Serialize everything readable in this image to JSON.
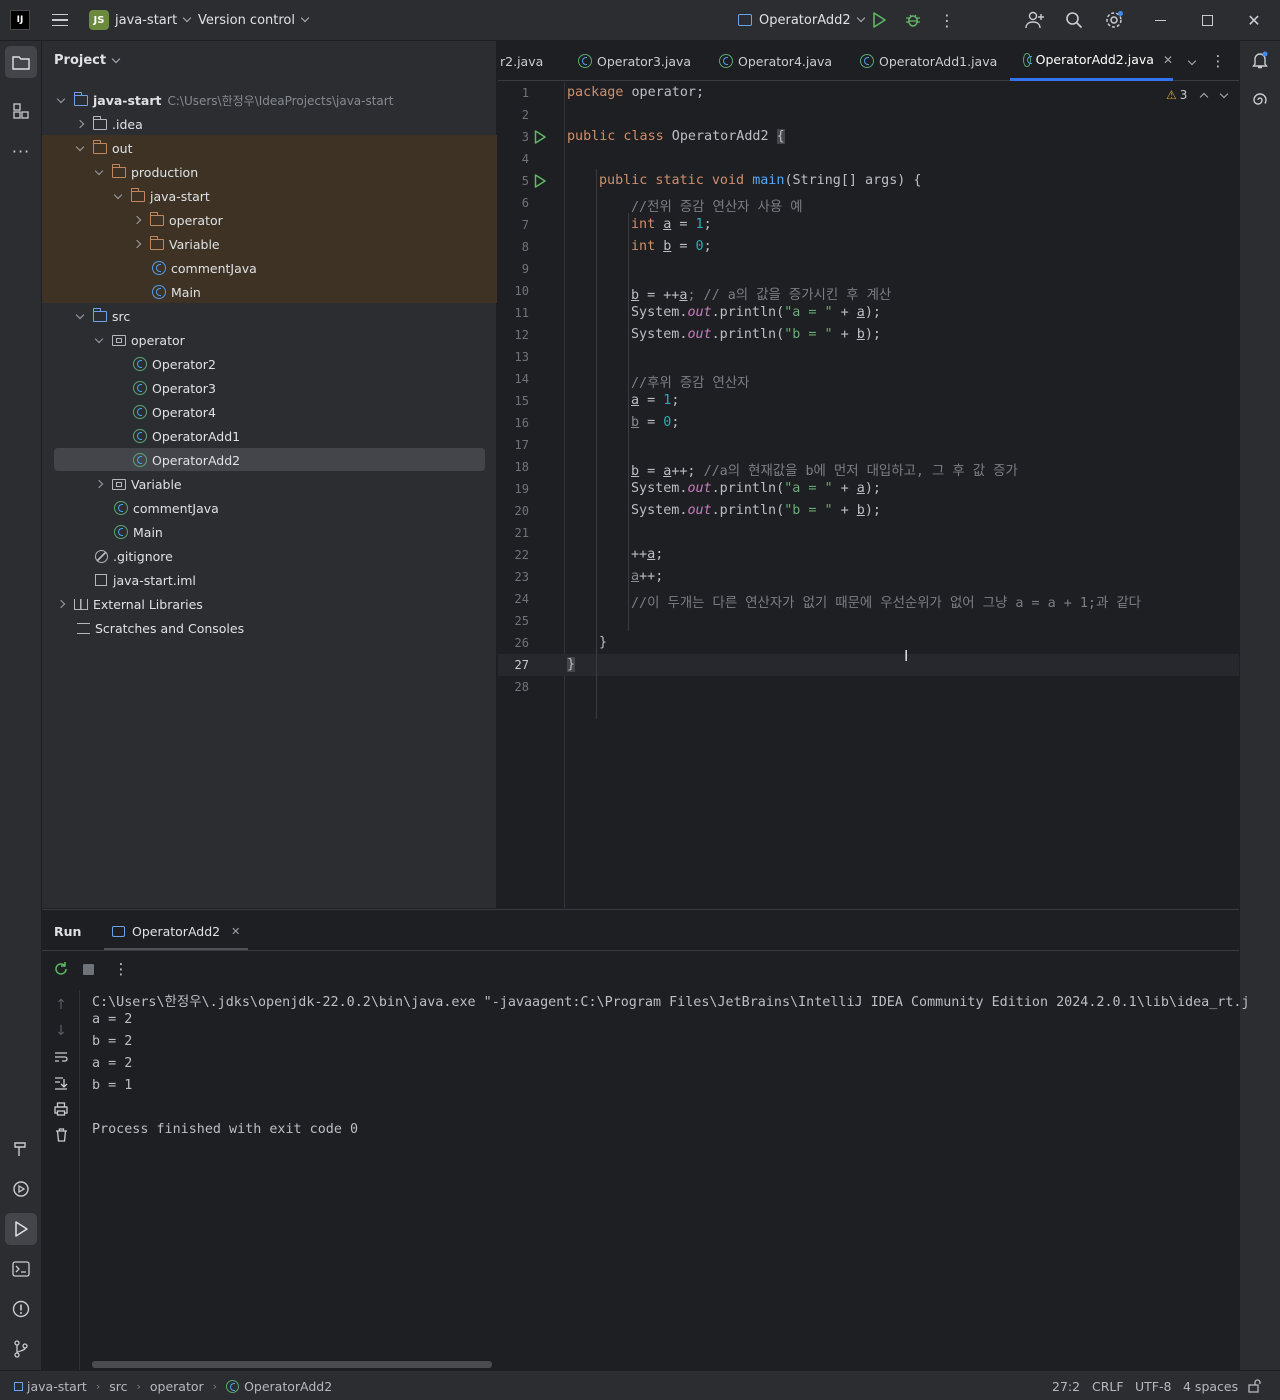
{
  "titlebar": {
    "project_badge": "JS",
    "project_name": "java-start",
    "vcs": "Version control",
    "run_config": "OperatorAdd2"
  },
  "project": {
    "header": "Project",
    "items": [
      {
        "label": "java-start",
        "path": "C:\\Users\\한정우\\IdeaProjects\\java-start"
      },
      {
        "label": ".idea"
      },
      {
        "label": "out"
      },
      {
        "label": "production"
      },
      {
        "label": "java-start"
      },
      {
        "label": "operator"
      },
      {
        "label": "Variable"
      },
      {
        "label": "commentJava"
      },
      {
        "label": "Main"
      },
      {
        "label": "src"
      },
      {
        "label": "operator"
      },
      {
        "label": "Operator2"
      },
      {
        "label": "Operator3"
      },
      {
        "label": "Operator4"
      },
      {
        "label": "OperatorAdd1"
      },
      {
        "label": "OperatorAdd2"
      },
      {
        "label": "Variable"
      },
      {
        "label": "commentJava"
      },
      {
        "label": "Main"
      },
      {
        "label": ".gitignore"
      },
      {
        "label": "java-start.iml"
      },
      {
        "label": "External Libraries"
      },
      {
        "label": "Scratches and Consoles"
      }
    ]
  },
  "tabs": [
    "r2.java",
    "Operator3.java",
    "Operator4.java",
    "OperatorAdd1.java",
    "OperatorAdd2.java"
  ],
  "editor": {
    "warnings": "3",
    "line_numbers": [
      "1",
      "2",
      "3",
      "4",
      "5",
      "6",
      "7",
      "8",
      "9",
      "10",
      "11",
      "12",
      "13",
      "14",
      "15",
      "16",
      "17",
      "18",
      "19",
      "20",
      "21",
      "22",
      "23",
      "24",
      "25",
      "26",
      "27",
      "28"
    ],
    "t": {
      "pkg": "package",
      "pkgname": " operator;",
      "pub": "public",
      "cls": " class",
      " clsname": " OperatorAdd2 ",
      "brace": "{",
      "static": " static void ",
      "main": "main",
      "args": "(String[] args) {",
      "c6": "//전위 증감 연산자 사용 예",
      "int": "int",
      "a": "a",
      "eq": " = ",
      "one": "1",
      "semi": ";",
      "b": "b",
      "zero": "0",
      "l10a": " = ++",
      "l10c": "; // a의 값을 증가시킨 후 계산",
      "sys": "System.",
      "out": "out",
      "println": ".println(",
      "sa": "\"a = \"",
      "plus": " + ",
      "close": ");",
      "sb": "\"b = \"",
      "c14": "//후위 증감 연산자",
      "l18a": " = ",
      "l18b": "++; ",
      "c18": "//a의 현재값을 b에 먼저 대입하고, 그 후 값 증가",
      "pp": "++",
      "c24": "//이 두개는 다른 연산자가 없기 때문에 우선순위가 없어 그냥 a = a + 1;과 같다",
      "rb": "}"
    }
  },
  "run": {
    "title": "Run",
    "tab": "OperatorAdd2",
    "lines": [
      "C:\\Users\\한정우\\.jdks\\openjdk-22.0.2\\bin\\java.exe \"-javaagent:C:\\Program Files\\JetBrains\\IntelliJ IDEA Community Edition 2024.2.0.1\\lib\\idea_rt.j",
      "a = 2",
      "b = 2",
      "a = 2",
      "b = 1",
      "",
      "Process finished with exit code 0"
    ]
  },
  "status": {
    "crumbs": [
      "java-start",
      "src",
      "operator",
      "OperatorAdd2"
    ],
    "pos": "27:2",
    "eol": "CRLF",
    "enc": "UTF-8",
    "indent": "4 spaces"
  }
}
